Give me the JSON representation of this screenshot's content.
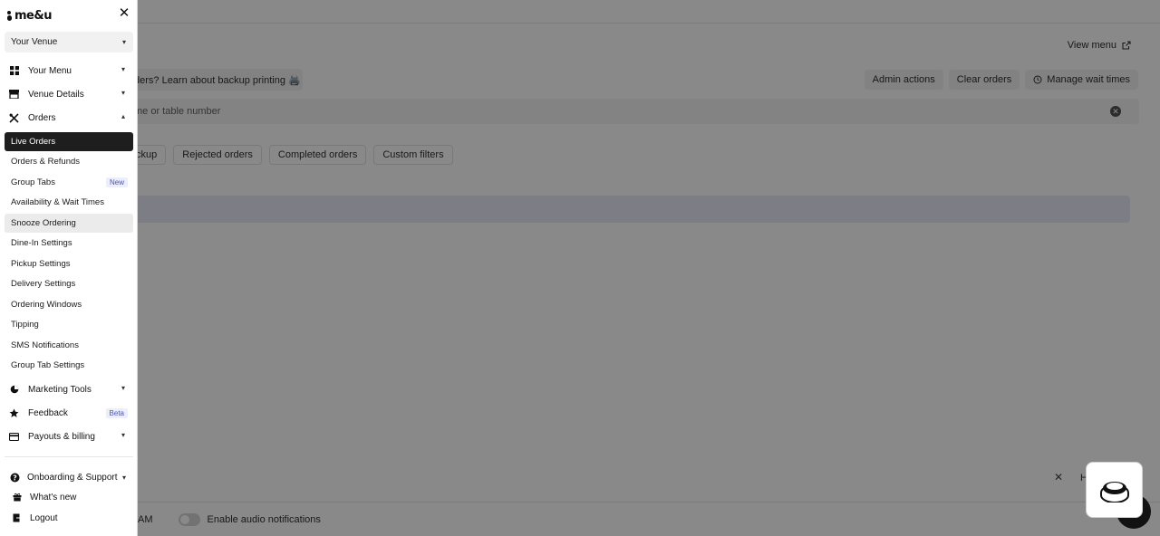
{
  "main": {
    "view_menu": "View menu",
    "banner_text": "ders? Learn about backup printing 🖨️",
    "actions": [
      "Admin actions",
      "Clear orders",
      "Manage wait times"
    ],
    "search_placeholder": "me or table number",
    "filters": [
      "ckup",
      "Rejected orders",
      "Completed orders",
      "Custom filters"
    ],
    "bottom_left_text": "AM",
    "audio_label": "Enable audio notifications",
    "help_text": "H"
  },
  "sidebar": {
    "brand": "me&u",
    "venue": "Your Venue",
    "sections": {
      "your_menu": "Your Menu",
      "venue_details": "Venue Details",
      "orders": "Orders",
      "marketing_tools": "Marketing Tools",
      "feedback": "Feedback",
      "feedback_badge": "Beta",
      "payouts": "Payouts & billing"
    },
    "order_items": [
      "Live Orders",
      "Orders & Refunds",
      "Group Tabs",
      "Availability & Wait Times",
      "Snooze Ordering",
      "Dine-In Settings",
      "Pickup Settings",
      "Delivery Settings",
      "Ordering Windows",
      "Tipping",
      "SMS Notifications",
      "Group Tab Settings"
    ],
    "group_tabs_badge": "New",
    "footer": {
      "support": "Onboarding & Support",
      "whats_new": "What's new",
      "logout": "Logout"
    }
  },
  "icons": [
    "close-icon",
    "chevron-down-icon",
    "chevron-up-icon",
    "grid-icon",
    "store-icon",
    "utensils-icon",
    "pie-chart-icon",
    "star-icon",
    "card-icon",
    "help-circle-icon",
    "gift-icon",
    "logout-icon",
    "external-link-icon",
    "clock-icon",
    "clear-icon",
    "chat-icon"
  ]
}
